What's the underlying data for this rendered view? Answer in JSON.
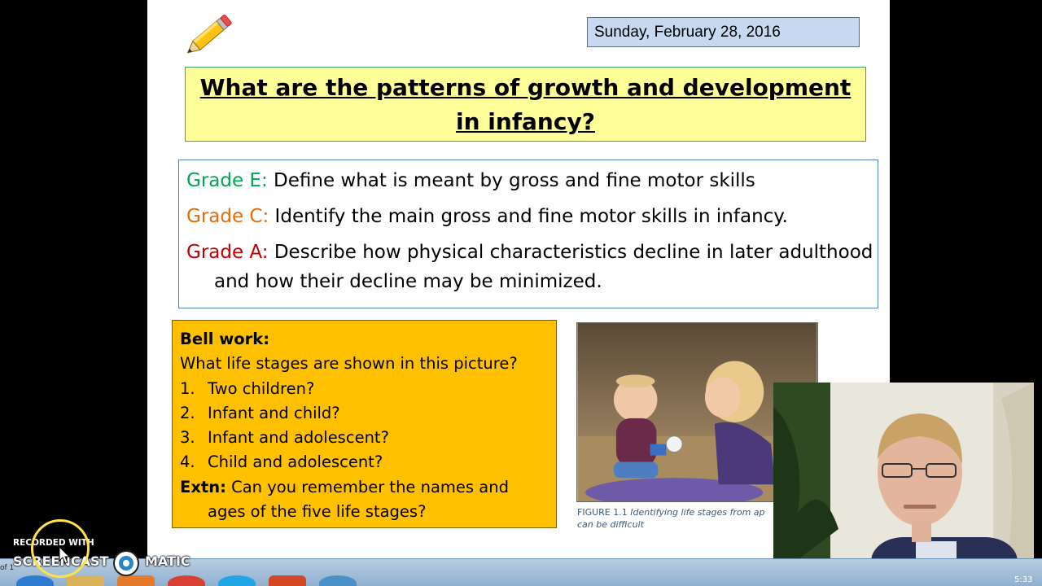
{
  "slide": {
    "date": "Sunday, February 28, 2016",
    "title": "What are the patterns of growth and development in infancy?",
    "objectives": [
      {
        "grade": "Grade E:",
        "text": " Define what is meant by gross and fine motor skills"
      },
      {
        "grade": "Grade C:",
        "text": " Identify the main gross and fine motor skills in infancy."
      },
      {
        "grade": "Grade A:",
        "text": " Describe how physical characteristics decline in later adulthood and how their decline may be minimized."
      }
    ],
    "bellwork": {
      "heading": "Bell work:",
      "question": "What life stages are shown in this picture?",
      "options": [
        {
          "num": "1.",
          "text": "Two children?"
        },
        {
          "num": "2.",
          "text": "Infant and child?"
        },
        {
          "num": "3.",
          "text": "Infant and adolescent?"
        },
        {
          "num": "4.",
          "text": "Child and adolescent?"
        }
      ],
      "extn_label": "Extn:",
      "extn_line1": " Can you remember the names and",
      "extn_line2": "ages of the five life stages?"
    },
    "caption": {
      "figure": "FIGURE 1.1",
      "text": " Identifying life stages from ap",
      "line2": "can be difficult"
    }
  },
  "watermark": {
    "recorded_with": "RECORDED WITH",
    "screencast": "SCREENCAST",
    "matic": "MATIC"
  },
  "taskbar": {
    "left_text": "of 1",
    "clock": "5:33"
  },
  "colors": {
    "grade_e": "#00a651",
    "grade_c": "#e36c09",
    "grade_a": "#c00000",
    "title_bg": "#ffff99",
    "bellwork_bg": "#ffc000",
    "date_bg": "#c6d9f1"
  }
}
